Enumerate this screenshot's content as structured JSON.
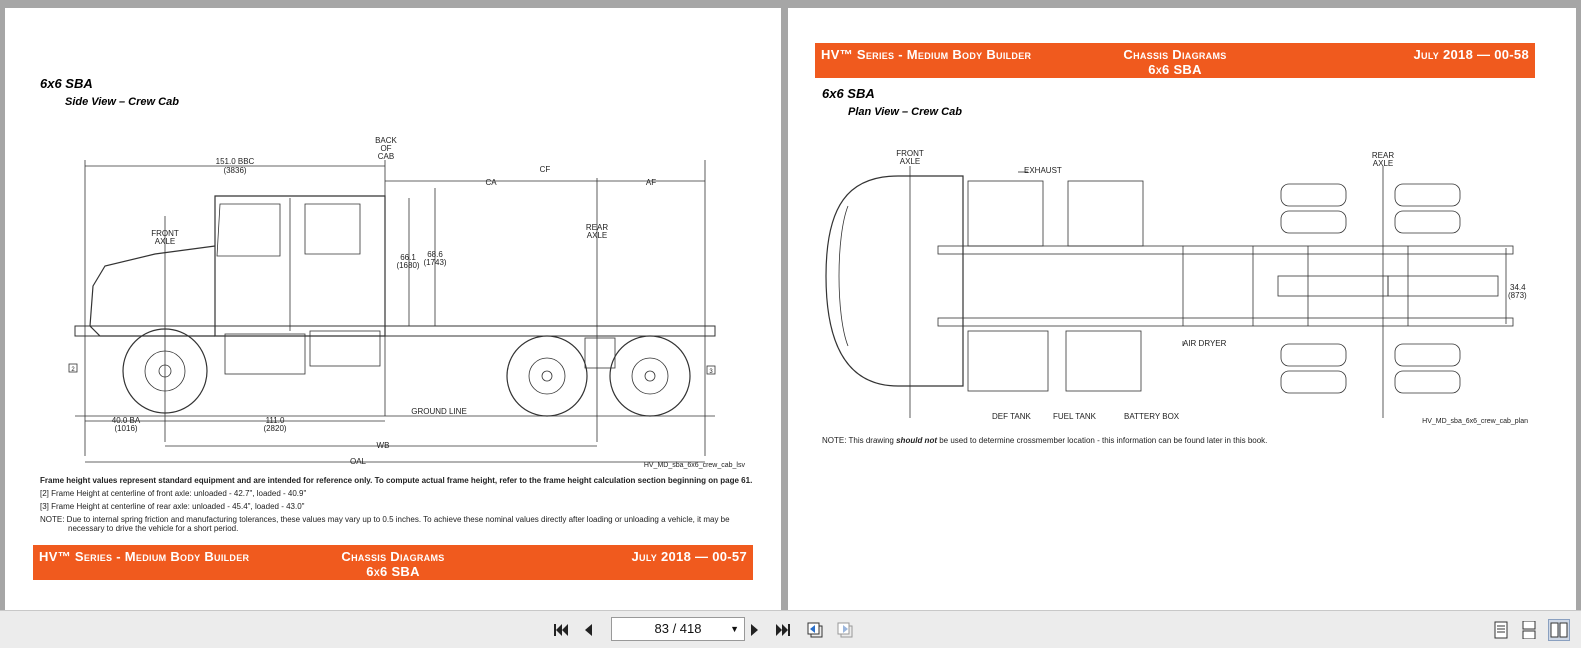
{
  "left_page": {
    "section_title": "6x6 SBA",
    "section_subtitle": "Side View – Crew Cab",
    "drawing_labels": {
      "bbc": "151.0 BBC",
      "bbc_mm": "(3836)",
      "back_of_cab_1": "BACK",
      "back_of_cab_2": "OF",
      "back_of_cab_3": "CAB",
      "ca": "CA",
      "cf": "CF",
      "af": "AF",
      "front_axle_1": "FRONT",
      "front_axle_2": "AXLE",
      "rear_axle_1": "REAR",
      "rear_axle_2": "AXLE",
      "h1": "66.1",
      "h1_mm": "(1680)",
      "h2": "68.6",
      "h2_mm": "(1743)",
      "ba": "40.0 BA",
      "ba_mm": "(1016)",
      "dim111": "111.0",
      "dim111_mm": "(2820)",
      "ground": "GROUND LINE",
      "wb": "WB",
      "oal": "OAL",
      "m2": "2",
      "m3": "3"
    },
    "file_ref": "HV_MD_sba_6x6_crew_cab_lsv",
    "note_bold": "Frame height values represent standard equipment and are intended for reference only. To compute actual frame height, refer to the frame height calculation section beginning on page 61.",
    "note_2": "[2]    Frame Height at centerline of front axle: unloaded - 42.7\", loaded - 40.9\"",
    "note_3": "[3]       Frame Height at centerline of rear axle: unloaded - 45.4\", loaded - 43.0\"",
    "note_4a": "NOTE:  Due to internal spring friction and manufacturing tolerances, these values may vary up to 0.5 inches.  To achieve these nominal values directly after loading or unloading a vehicle, it may be",
    "note_4b": "necessary to drive the vehicle for a short period.",
    "band_left": "HV™ Series - Medium Body Builder",
    "band_center_1": "Chassis Diagrams",
    "band_center_2": "6x6 SBA",
    "band_right": "July 2018 — 00-57"
  },
  "right_page": {
    "band_left": "HV™ Series - Medium Body Builder",
    "band_center_1": "Chassis Diagrams",
    "band_center_2": "6x6 SBA",
    "band_right": "July 2018 — 00-58",
    "section_title": "6x6 SBA",
    "section_subtitle": "Plan View – Crew Cab",
    "drawing_labels": {
      "front_axle_1": "FRONT",
      "front_axle_2": "AXLE",
      "exhaust": "EXHAUST",
      "rear_axle_1": "REAR",
      "rear_axle_2": "AXLE",
      "width": "34.4",
      "width_mm": "(873)",
      "air_dryer": "AIR DRYER",
      "def_tank": "DEF TANK",
      "fuel_tank": "FUEL TANK",
      "battery_box": "BATTERY BOX"
    },
    "file_ref": "HV_MD_sba_6x6_crew_cab_plan",
    "note_prefix": "NOTE:  This drawing ",
    "note_emph": "should not",
    "note_suffix": " be used to determine crossmember location - this information can be found later in this book."
  },
  "toolbar": {
    "page_indicator": "83 / 418",
    "icons": [
      "first-page-icon",
      "prev-page-icon",
      "next-page-icon",
      "last-page-icon",
      "history-back-icon",
      "history-forward-icon",
      "single-page-view-icon",
      "continuous-view-icon",
      "facing-pages-view-icon"
    ]
  }
}
